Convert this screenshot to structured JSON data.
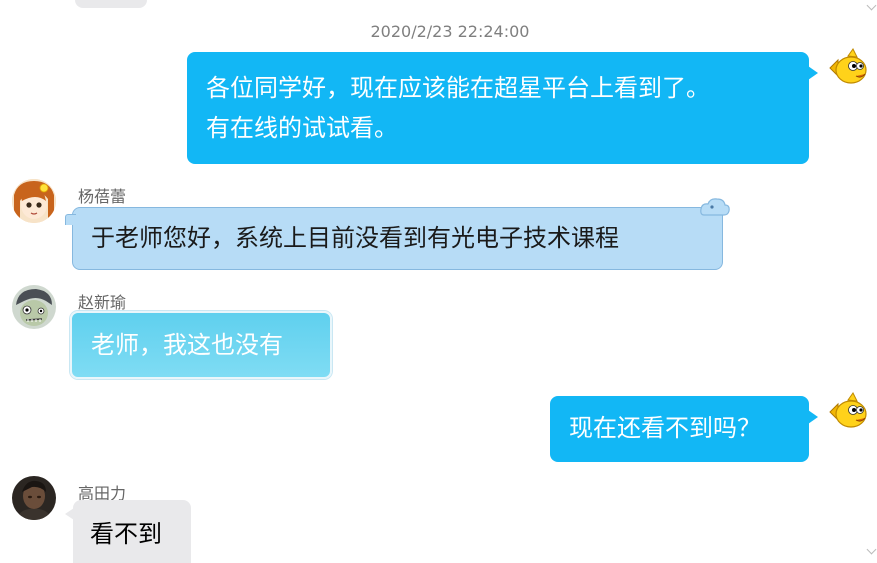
{
  "timestamp": "2020/2/23 22:24:00",
  "messages": [
    {
      "direction": "out",
      "text_line1": "各位同学好，现在应该能在超星平台上看到了。",
      "text_line2": "有在线的试试看。"
    },
    {
      "direction": "in",
      "sender": "杨蓓蕾",
      "text": "于老师您好，系统上目前没看到有光电子技术课程"
    },
    {
      "direction": "in",
      "sender": "赵新瑜",
      "text": "老师，我这也没有"
    },
    {
      "direction": "out",
      "text": "现在还看不到吗？"
    },
    {
      "direction": "in",
      "sender": "高田力",
      "text": "看不到"
    }
  ],
  "colors": {
    "outgoing_bubble": "#12b7f5",
    "incoming_blue_bubble": "#b7dcf6",
    "incoming_cyan_bubble": "#6fd6f1",
    "incoming_gray_bubble": "#e9e9eb"
  },
  "icons": {
    "self_avatar": "yellow-fish-avatar",
    "avatar_1": "cartoon-girl-avatar",
    "avatar_2": "zombie-avatar",
    "avatar_3": "photo-avatar"
  }
}
